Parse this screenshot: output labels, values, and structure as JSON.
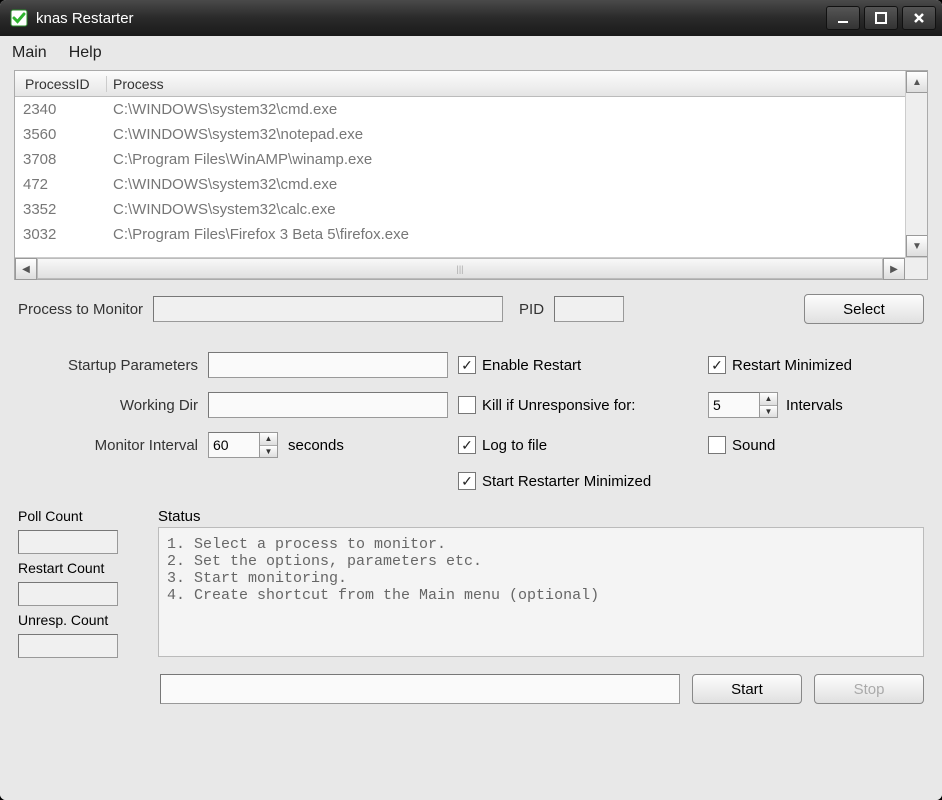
{
  "title": "knas Restarter",
  "menu": {
    "main": "Main",
    "help": "Help"
  },
  "columns": {
    "pid": "ProcessID",
    "proc": "Process"
  },
  "processes": [
    {
      "pid": "2340",
      "path": "C:\\WINDOWS\\system32\\cmd.exe"
    },
    {
      "pid": "3560",
      "path": "C:\\WINDOWS\\system32\\notepad.exe"
    },
    {
      "pid": "3708",
      "path": "C:\\Program Files\\WinAMP\\winamp.exe"
    },
    {
      "pid": "472",
      "path": "C:\\WINDOWS\\system32\\cmd.exe"
    },
    {
      "pid": "3352",
      "path": "C:\\WINDOWS\\system32\\calc.exe"
    },
    {
      "pid": "3032",
      "path": "C:\\Program Files\\Firefox 3 Beta 5\\firefox.exe"
    }
  ],
  "labels": {
    "process_to_monitor": "Process to Monitor",
    "pid": "PID",
    "select": "Select",
    "startup_params": "Startup Parameters",
    "working_dir": "Working Dir",
    "monitor_interval": "Monitor Interval",
    "seconds": "seconds",
    "enable_restart": "Enable Restart",
    "restart_minimized": "Restart Minimized",
    "kill_unresponsive": "Kill if Unresponsive for:",
    "intervals": "Intervals",
    "log_to_file": "Log to file",
    "sound": "Sound",
    "start_minimized": "Start Restarter Minimized",
    "poll_count": "Poll Count",
    "restart_count": "Restart Count",
    "unresp_count": "Unresp. Count",
    "status": "Status",
    "start": "Start",
    "stop": "Stop"
  },
  "values": {
    "process_to_monitor": "",
    "pid": "",
    "startup_params": "",
    "working_dir": "",
    "monitor_interval": "60",
    "kill_intervals": "5",
    "poll_count": "",
    "restart_count": "",
    "unresp_count": "",
    "footer_input": ""
  },
  "checkboxes": {
    "enable_restart": true,
    "restart_minimized": true,
    "kill_unresponsive": false,
    "log_to_file": true,
    "sound": false,
    "start_minimized": true
  },
  "status_text": "1. Select a process to monitor.\n2. Set the options, parameters etc.\n3. Start monitoring.\n4. Create shortcut from the Main menu (optional)"
}
